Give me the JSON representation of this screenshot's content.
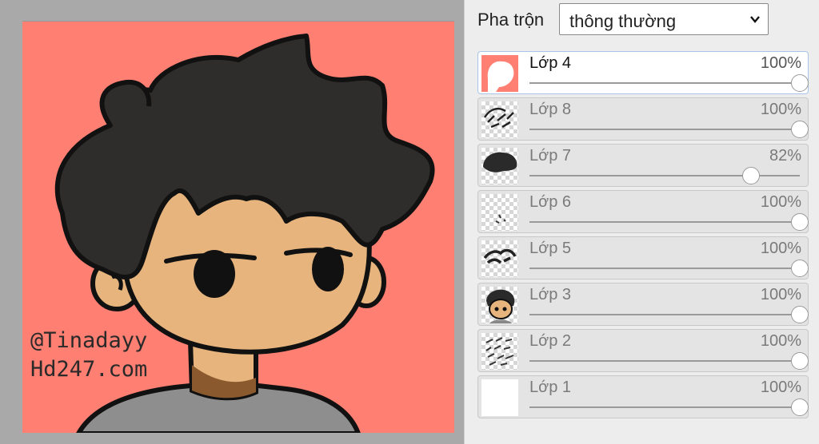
{
  "canvas": {
    "watermark_line1": "@Tinadayy",
    "watermark_line2": "Hd247.com",
    "background_color": "#ff7f72"
  },
  "panel": {
    "blend_label": "Pha trộn",
    "blend_value": "thông thường",
    "blend_icon": "chevron-down-icon",
    "layers": [
      {
        "name": "Lớp 4",
        "opacity": "100%",
        "level": 1.0,
        "active": true,
        "thumb": "pink-bg-with-mask"
      },
      {
        "name": "Lớp 8",
        "opacity": "100%",
        "level": 1.0,
        "active": false,
        "thumb": "scribble-detail"
      },
      {
        "name": "Lớp 7",
        "opacity": "82%",
        "level": 0.82,
        "active": false,
        "thumb": "hair-shadow"
      },
      {
        "name": "Lớp 6",
        "opacity": "100%",
        "level": 1.0,
        "active": false,
        "thumb": "small-marks"
      },
      {
        "name": "Lớp 5",
        "opacity": "100%",
        "level": 1.0,
        "active": false,
        "thumb": "hair-strokes"
      },
      {
        "name": "Lớp 3",
        "opacity": "100%",
        "level": 1.0,
        "active": false,
        "thumb": "character-face"
      },
      {
        "name": "Lớp 2",
        "opacity": "100%",
        "level": 1.0,
        "active": false,
        "thumb": "sketch"
      },
      {
        "name": "Lớp 1",
        "opacity": "100%",
        "level": 1.0,
        "active": false,
        "thumb": "white-fill"
      }
    ]
  }
}
